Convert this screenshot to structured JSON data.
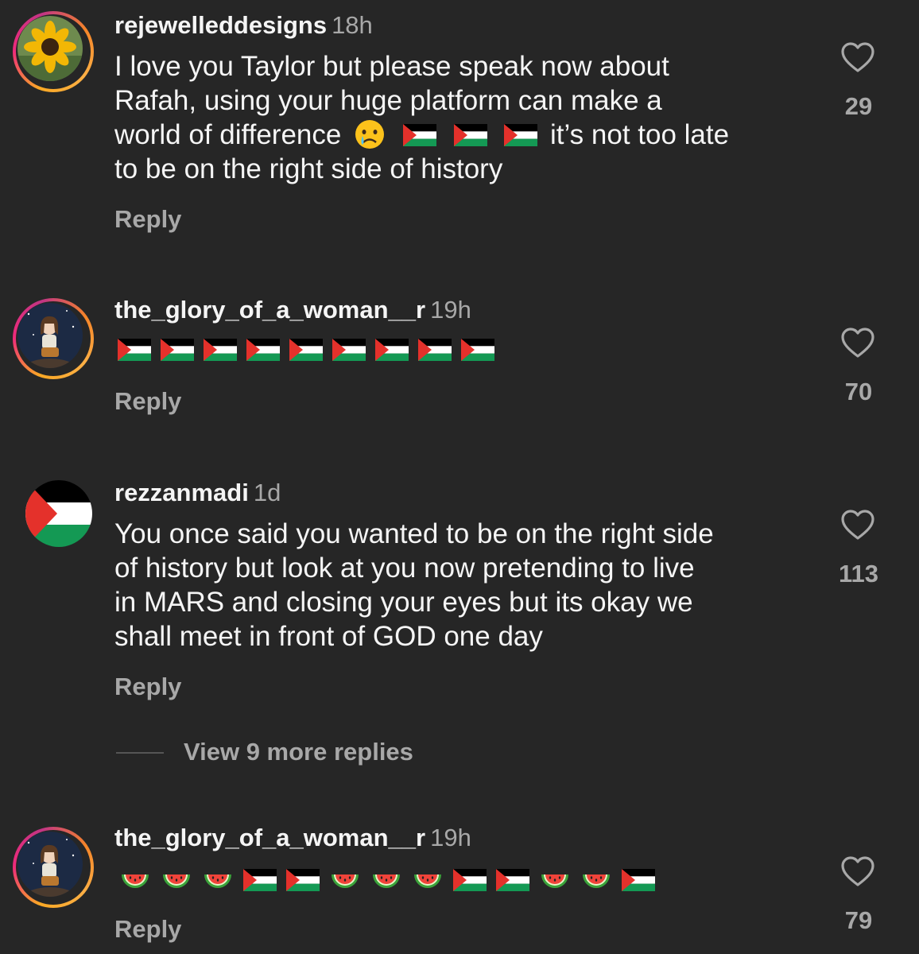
{
  "comments": [
    {
      "username": "rejewelleddesigns",
      "time": "18h",
      "text": [
        "I love you Taylor but please speak now about",
        "Rafah, using your huge platform can make a",
        "world of difference",
        "it’s not too late",
        "to be on the right side of history"
      ],
      "emoji": [
        "crying-face",
        "palestine-flag",
        "palestine-flag",
        "palestine-flag"
      ],
      "reply": "Reply",
      "likes": "29",
      "avatar": "sunflower"
    },
    {
      "username": "the_glory_of_a_woman__r",
      "time": "19h",
      "emoji": [
        "palestine-flag",
        "palestine-flag",
        "palestine-flag",
        "palestine-flag",
        "palestine-flag",
        "palestine-flag",
        "palestine-flag",
        "palestine-flag",
        "palestine-flag"
      ],
      "reply": "Reply",
      "likes": "70",
      "avatar": "girl-night-sky"
    },
    {
      "username": "rezzanmadi",
      "time": "1d",
      "text": [
        "You once said you wanted to be on the right side",
        "of history but look at you now pretending to live",
        "in MARS and closing your eyes but its okay we",
        "shall meet in front of GOD one day"
      ],
      "reply": "Reply",
      "likes": "113",
      "view_more": "View 9 more replies",
      "avatar": "palestine-flag"
    },
    {
      "username": "the_glory_of_a_woman__r",
      "time": "19h",
      "emoji": [
        "watermelon",
        "watermelon",
        "watermelon",
        "palestine-flag",
        "palestine-flag",
        "watermelon",
        "watermelon",
        "watermelon",
        "palestine-flag",
        "palestine-flag",
        "watermelon",
        "watermelon",
        "palestine-flag"
      ],
      "reply": "Reply",
      "likes": "79",
      "avatar": "girl-night-sky"
    }
  ],
  "colors": {
    "background": "#262626",
    "text": "#f5f5f5",
    "muted": "#a8a8a8",
    "flag_red": "#e4312b",
    "flag_green": "#149954"
  }
}
